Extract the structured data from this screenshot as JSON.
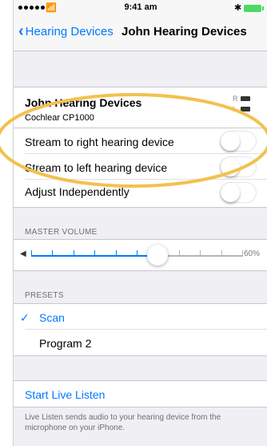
{
  "status": {
    "time": "9:41 am",
    "wifi_icon": "wifi-icon",
    "bluetooth_icon": "bluetooth-icon"
  },
  "nav": {
    "back_label": "Hearing Devices",
    "title": "John Hearing Devices"
  },
  "device": {
    "name": "John Hearing Devices",
    "model": "Cochlear CP1000",
    "right_label": "R",
    "left_label": "L"
  },
  "toggles": {
    "stream_right": "Stream to right hearing device",
    "stream_left": "Stream to left hearing device",
    "adjust": "Adjust Independently"
  },
  "volume": {
    "header": "MASTER VOLUME",
    "level": 0.6,
    "percent_label": "60%"
  },
  "presets": {
    "header": "PRESETS",
    "items": [
      "Scan",
      "Program 2"
    ],
    "selected": "Scan"
  },
  "live_listen": {
    "label": "Start Live Listen",
    "footer": "Live Listen sends audio to your hearing device from the microphone on your iPhone."
  },
  "colors": {
    "accent": "#007aff",
    "annotation": "#f2c14e",
    "battery": "#4cd964"
  }
}
